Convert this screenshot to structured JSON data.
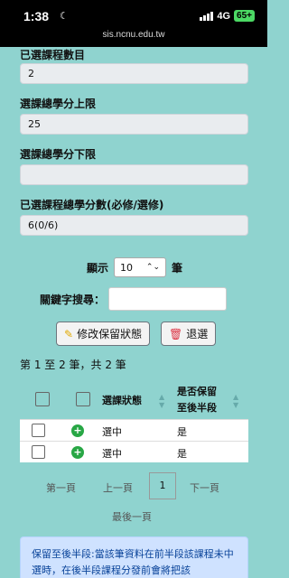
{
  "status_bar": {
    "time": "1:38",
    "network": "4G",
    "battery": "65+",
    "url": "sis.ncnu.edu.tw"
  },
  "fields": [
    {
      "label": "已選課程數目",
      "value": "2"
    },
    {
      "label": "選課總學分上限",
      "value": "25"
    },
    {
      "label": "選課總學分下限",
      "value": ""
    },
    {
      "label": "已選課程總學分數(必修/選修)",
      "value": "6(0/6)"
    }
  ],
  "display": {
    "prefix": "顯示",
    "selected": "10",
    "suffix": "筆"
  },
  "search": {
    "label": "關鍵字搜尋：",
    "value": ""
  },
  "actions": {
    "edit_label": "修改保留狀態",
    "withdraw_label": "退選"
  },
  "table": {
    "count_text": "第 1 至 2 筆，共 2 筆",
    "headers": {
      "status": "選課狀態",
      "retain_line1": "是否保留",
      "retain_line2": "至後半段"
    },
    "rows": [
      {
        "status": "選中",
        "retain": "是"
      },
      {
        "status": "選中",
        "retain": "是"
      }
    ]
  },
  "pagination": {
    "first": "第一頁",
    "prev": "上一頁",
    "current": "1",
    "next": "下一頁",
    "last": "最後一頁"
  },
  "notice": {
    "text": "保留至後半段:當該筆資料在前半段該課程未中選時，在後半段課程分發前會將把該"
  },
  "colors": {
    "background": "#8fd3cf",
    "notice_bg": "#cfe2ff",
    "plus": "#28a745"
  }
}
